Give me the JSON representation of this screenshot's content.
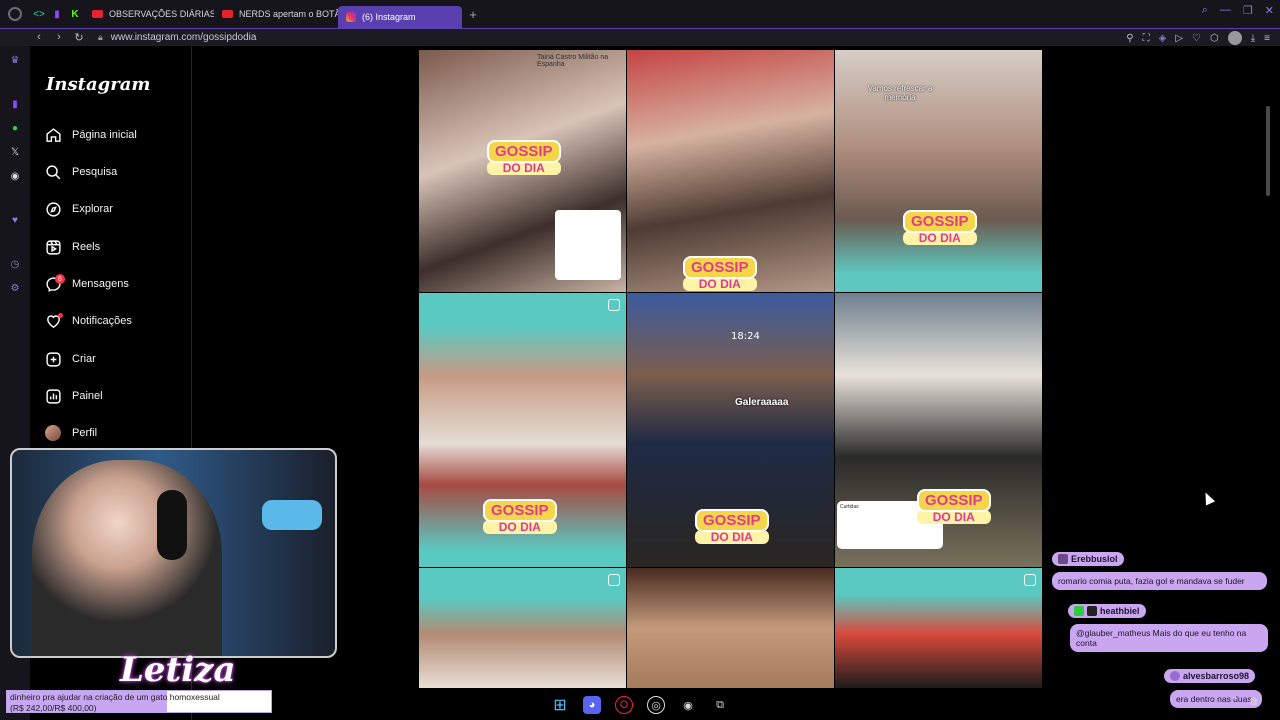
{
  "browser": {
    "tabs": [
      {
        "label": "OBSERVAÇÕES DIÁRIAS",
        "icon": "youtube-icon"
      },
      {
        "label": "NERDS apertam o BOTÃO",
        "icon": "youtube-icon"
      },
      {
        "label": "(6) Instagram",
        "icon": "instagram-icon",
        "active": true
      }
    ],
    "url": "www.instagram.com/gossipdodia",
    "accent": "#5a3fb0"
  },
  "instagram": {
    "logo": "Instagram",
    "nav": [
      {
        "label": "Página inicial",
        "icon": "home-icon"
      },
      {
        "label": "Pesquisa",
        "icon": "search-icon"
      },
      {
        "label": "Explorar",
        "icon": "compass-icon"
      },
      {
        "label": "Reels",
        "icon": "reels-icon"
      },
      {
        "label": "Mensagens",
        "icon": "messenger-icon",
        "badge": "6"
      },
      {
        "label": "Notificações",
        "icon": "heart-icon"
      },
      {
        "label": "Criar",
        "icon": "plus-square-icon"
      },
      {
        "label": "Painel",
        "icon": "dashboard-icon"
      },
      {
        "label": "Perfil",
        "icon": "avatar"
      }
    ],
    "posts": [
      {
        "gossip": "GOSSIP",
        "do_dia": "DO DIA",
        "caption": "Tainá Castro Militão na Espanha"
      },
      {
        "gossip": "GOSSIP",
        "do_dia": "DO DIA",
        "caption": ""
      },
      {
        "gossip": "GOSSIP",
        "do_dia": "DO DIA",
        "caption": "Vamos refrescar a memória"
      },
      {
        "gossip": "GOSSIP",
        "do_dia": "DO DIA",
        "caption": ""
      },
      {
        "gossip": "GOSSIP",
        "do_dia": "DO DIA",
        "caption": "Galeraaaaa",
        "time": "18:24"
      },
      {
        "gossip": "GOSSIP",
        "do_dia": "DO DIA",
        "caption": "Curtidas"
      },
      {
        "gossip": "",
        "do_dia": "",
        "caption": ""
      },
      {
        "gossip": "",
        "do_dia": "",
        "caption": ""
      },
      {
        "gossip": "",
        "do_dia": "",
        "caption": ""
      }
    ]
  },
  "stream": {
    "streamer": "Letiza",
    "goal_line1": "dinheiro pra ajudar na criação de um gato homoxessual",
    "goal_line2": "(R$ 242,00/R$ 400,00)",
    "goal_progress": 0.605,
    "chat": [
      {
        "user": "Erebbuslol",
        "message": "romario comia puta, fazia gol e mandava se fuder"
      },
      {
        "user": "heathbiel",
        "message": "@glauber_matheus Mais do que eu tenho na conta"
      },
      {
        "user": "alvesbarroso98",
        "message": "era dentro nas duas"
      }
    ]
  }
}
